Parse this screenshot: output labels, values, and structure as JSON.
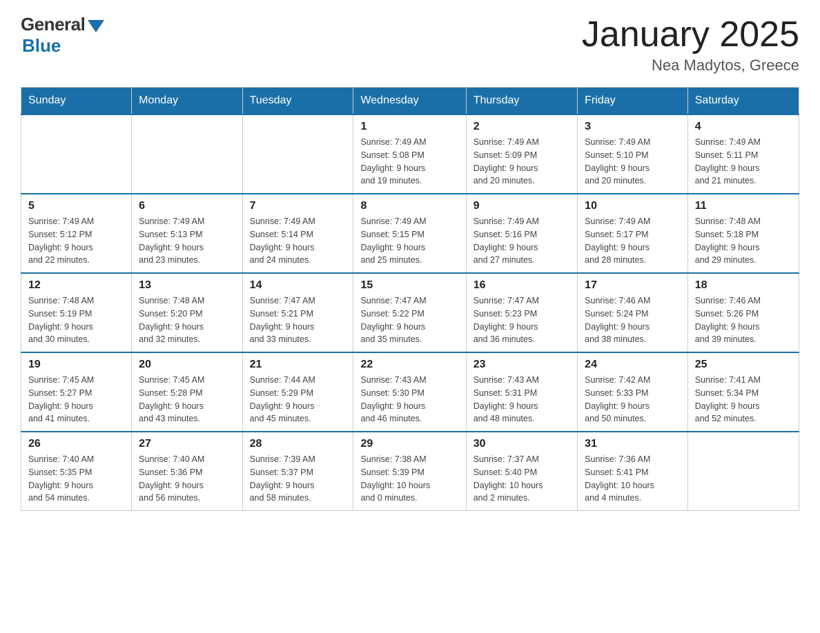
{
  "logo": {
    "general": "General",
    "blue": "Blue"
  },
  "title": {
    "month_year": "January 2025",
    "location": "Nea Madytos, Greece"
  },
  "weekdays": [
    "Sunday",
    "Monday",
    "Tuesday",
    "Wednesday",
    "Thursday",
    "Friday",
    "Saturday"
  ],
  "weeks": [
    [
      null,
      null,
      null,
      {
        "day": "1",
        "sunrise": "7:49 AM",
        "sunset": "5:08 PM",
        "daylight": "9 hours and 19 minutes."
      },
      {
        "day": "2",
        "sunrise": "7:49 AM",
        "sunset": "5:09 PM",
        "daylight": "9 hours and 20 minutes."
      },
      {
        "day": "3",
        "sunrise": "7:49 AM",
        "sunset": "5:10 PM",
        "daylight": "9 hours and 20 minutes."
      },
      {
        "day": "4",
        "sunrise": "7:49 AM",
        "sunset": "5:11 PM",
        "daylight": "9 hours and 21 minutes."
      }
    ],
    [
      {
        "day": "5",
        "sunrise": "7:49 AM",
        "sunset": "5:12 PM",
        "daylight": "9 hours and 22 minutes."
      },
      {
        "day": "6",
        "sunrise": "7:49 AM",
        "sunset": "5:13 PM",
        "daylight": "9 hours and 23 minutes."
      },
      {
        "day": "7",
        "sunrise": "7:49 AM",
        "sunset": "5:14 PM",
        "daylight": "9 hours and 24 minutes."
      },
      {
        "day": "8",
        "sunrise": "7:49 AM",
        "sunset": "5:15 PM",
        "daylight": "9 hours and 25 minutes."
      },
      {
        "day": "9",
        "sunrise": "7:49 AM",
        "sunset": "5:16 PM",
        "daylight": "9 hours and 27 minutes."
      },
      {
        "day": "10",
        "sunrise": "7:49 AM",
        "sunset": "5:17 PM",
        "daylight": "9 hours and 28 minutes."
      },
      {
        "day": "11",
        "sunrise": "7:48 AM",
        "sunset": "5:18 PM",
        "daylight": "9 hours and 29 minutes."
      }
    ],
    [
      {
        "day": "12",
        "sunrise": "7:48 AM",
        "sunset": "5:19 PM",
        "daylight": "9 hours and 30 minutes."
      },
      {
        "day": "13",
        "sunrise": "7:48 AM",
        "sunset": "5:20 PM",
        "daylight": "9 hours and 32 minutes."
      },
      {
        "day": "14",
        "sunrise": "7:47 AM",
        "sunset": "5:21 PM",
        "daylight": "9 hours and 33 minutes."
      },
      {
        "day": "15",
        "sunrise": "7:47 AM",
        "sunset": "5:22 PM",
        "daylight": "9 hours and 35 minutes."
      },
      {
        "day": "16",
        "sunrise": "7:47 AM",
        "sunset": "5:23 PM",
        "daylight": "9 hours and 36 minutes."
      },
      {
        "day": "17",
        "sunrise": "7:46 AM",
        "sunset": "5:24 PM",
        "daylight": "9 hours and 38 minutes."
      },
      {
        "day": "18",
        "sunrise": "7:46 AM",
        "sunset": "5:26 PM",
        "daylight": "9 hours and 39 minutes."
      }
    ],
    [
      {
        "day": "19",
        "sunrise": "7:45 AM",
        "sunset": "5:27 PM",
        "daylight": "9 hours and 41 minutes."
      },
      {
        "day": "20",
        "sunrise": "7:45 AM",
        "sunset": "5:28 PM",
        "daylight": "9 hours and 43 minutes."
      },
      {
        "day": "21",
        "sunrise": "7:44 AM",
        "sunset": "5:29 PM",
        "daylight": "9 hours and 45 minutes."
      },
      {
        "day": "22",
        "sunrise": "7:43 AM",
        "sunset": "5:30 PM",
        "daylight": "9 hours and 46 minutes."
      },
      {
        "day": "23",
        "sunrise": "7:43 AM",
        "sunset": "5:31 PM",
        "daylight": "9 hours and 48 minutes."
      },
      {
        "day": "24",
        "sunrise": "7:42 AM",
        "sunset": "5:33 PM",
        "daylight": "9 hours and 50 minutes."
      },
      {
        "day": "25",
        "sunrise": "7:41 AM",
        "sunset": "5:34 PM",
        "daylight": "9 hours and 52 minutes."
      }
    ],
    [
      {
        "day": "26",
        "sunrise": "7:40 AM",
        "sunset": "5:35 PM",
        "daylight": "9 hours and 54 minutes."
      },
      {
        "day": "27",
        "sunrise": "7:40 AM",
        "sunset": "5:36 PM",
        "daylight": "9 hours and 56 minutes."
      },
      {
        "day": "28",
        "sunrise": "7:39 AM",
        "sunset": "5:37 PM",
        "daylight": "9 hours and 58 minutes."
      },
      {
        "day": "29",
        "sunrise": "7:38 AM",
        "sunset": "5:39 PM",
        "daylight": "10 hours and 0 minutes."
      },
      {
        "day": "30",
        "sunrise": "7:37 AM",
        "sunset": "5:40 PM",
        "daylight": "10 hours and 2 minutes."
      },
      {
        "day": "31",
        "sunrise": "7:36 AM",
        "sunset": "5:41 PM",
        "daylight": "10 hours and 4 minutes."
      },
      null
    ]
  ],
  "labels": {
    "sunrise": "Sunrise: ",
    "sunset": "Sunset: ",
    "daylight": "Daylight: "
  }
}
